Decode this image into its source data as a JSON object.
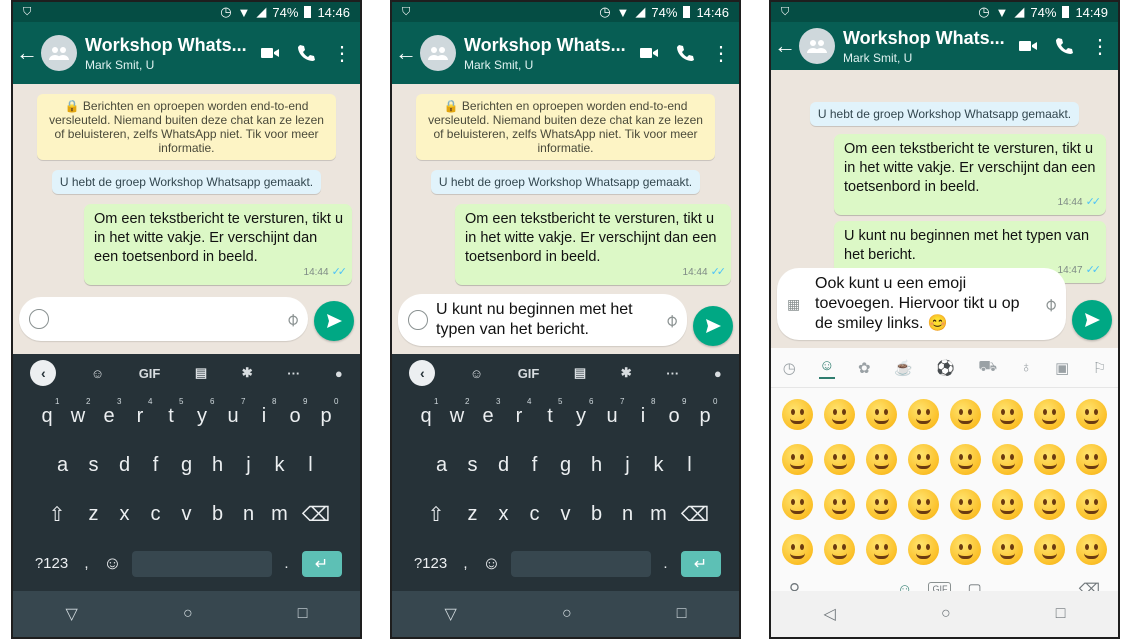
{
  "phones": [
    {
      "status": {
        "time": "14:46",
        "battery": "74%"
      },
      "header": {
        "title": "Workshop Whats...",
        "subtitle": "Mark Smit, U"
      },
      "encryption_notice": "🔒 Berichten en oproepen worden end-to-end versleuteld. Niemand buiten deze chat kan ze lezen of beluisteren, zelfs WhatsApp niet. Tik voor meer informatie.",
      "group_created": "U hebt de groep Workshop Whatsapp gemaakt.",
      "messages": [
        {
          "text": "Om een tekstbericht te versturen, tikt u in het witte vakje. Er verschijnt dan een toetsenbord in beeld.",
          "time": "14:44"
        }
      ],
      "input": {
        "text": ""
      }
    },
    {
      "status": {
        "time": "14:46",
        "battery": "74%"
      },
      "header": {
        "title": "Workshop Whats...",
        "subtitle": "Mark Smit, U"
      },
      "encryption_notice": "🔒 Berichten en oproepen worden end-to-end versleuteld. Niemand buiten deze chat kan ze lezen of beluisteren, zelfs WhatsApp niet. Tik voor meer informatie.",
      "group_created": "U hebt de groep Workshop Whatsapp gemaakt.",
      "messages": [
        {
          "text": "Om een tekstbericht te versturen, tikt u in het witte vakje. Er verschijnt dan een toetsenbord in beeld.",
          "time": "14:44"
        }
      ],
      "input": {
        "text": "U kunt nu beginnen met het typen van het bericht."
      }
    },
    {
      "status": {
        "time": "14:49",
        "battery": "74%"
      },
      "header": {
        "title": "Workshop Whats...",
        "subtitle": "Mark Smit, U"
      },
      "group_created": "U hebt de groep Workshop Whatsapp gemaakt.",
      "messages": [
        {
          "text": "Om een tekstbericht te versturen, tikt u in het witte vakje. Er verschijnt dan een toetsenbord in beeld.",
          "time": "14:44"
        },
        {
          "text": "U kunt nu beginnen met het typen van het bericht.",
          "time": "14:47"
        }
      ],
      "input": {
        "text": "Ook kunt u een emoji toevoegen. Hiervoor tikt u op de smiley links. 😊"
      }
    }
  ],
  "keyboard": {
    "toolbar": [
      "GIF"
    ],
    "row1": [
      "q",
      "w",
      "e",
      "r",
      "t",
      "y",
      "u",
      "i",
      "o",
      "p"
    ],
    "row1_numbers": [
      "1",
      "2",
      "3",
      "4",
      "5",
      "6",
      "7",
      "8",
      "9",
      "0"
    ],
    "row2": [
      "a",
      "s",
      "d",
      "f",
      "g",
      "h",
      "j",
      "k",
      "l"
    ],
    "row3": [
      "z",
      "x",
      "c",
      "v",
      "b",
      "n",
      "m"
    ],
    "numbers_key": "?123",
    "comma": ",",
    "period": "."
  },
  "emoji_keyboard": {
    "gif_label": "GIF"
  },
  "icons": [
    "shield-icon",
    "alarm-icon",
    "wifi-icon",
    "signal-icon",
    "battery-icon",
    "back-arrow-icon",
    "group-avatar-icon",
    "video-call-icon",
    "phone-icon",
    "more-icon",
    "lock-icon",
    "blue-ticks-icon",
    "smiley-icon",
    "paperclip-icon",
    "send-icon",
    "keyboard-icon",
    "mic-icon",
    "settings-icon",
    "clipboard-icon",
    "sticker-icon",
    "backspace-icon",
    "shift-icon",
    "enter-icon",
    "nav-back-icon",
    "nav-home-icon",
    "nav-recents-icon"
  ],
  "colors": {
    "header": "#075e54",
    "status_bar": "#054d44",
    "outgoing_bubble": "#dcf8c6",
    "send_button": "#00a884",
    "keyboard_bg": "#263238",
    "chat_bg": "#ece5dd"
  }
}
